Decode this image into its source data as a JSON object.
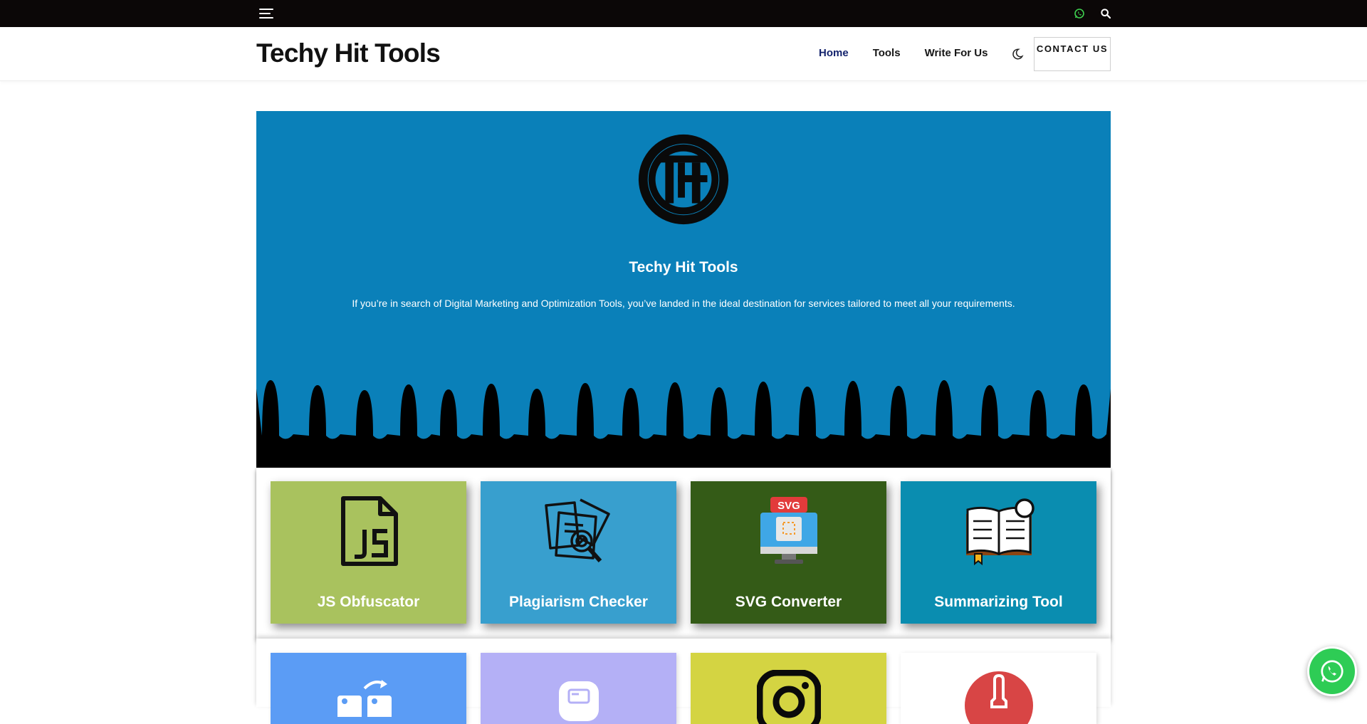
{
  "topbar": {
    "menu_icon": "hamburger-icon",
    "whatsapp_icon": "whatsapp-icon",
    "search_icon": "search-icon"
  },
  "header": {
    "brand": "Techy Hit Tools",
    "nav": [
      {
        "label": "Home",
        "active": true
      },
      {
        "label": "Tools",
        "active": false
      },
      {
        "label": "Write For Us",
        "active": false
      }
    ],
    "theme_icon": "moon-icon",
    "contact_label": "CONTACT US"
  },
  "hero": {
    "logo_icon": "th-logo-icon",
    "title": "Techy Hit Tools",
    "tagline": "If you’re in search of Digital Marketing and Optimization Tools, you’ve landed in the ideal destination for services tailored to meet all your requirements.",
    "bg_color": "#0a80b9"
  },
  "tools": [
    {
      "label": "JS Obfuscator",
      "color": "#a9c25e",
      "icon": "js-file-icon"
    },
    {
      "label": "Plagiarism Checker",
      "color": "#389fce",
      "icon": "documents-magnifier-icon"
    },
    {
      "label": "SVG Converter",
      "color": "#345b17",
      "icon": "svg-monitor-icon"
    },
    {
      "label": "Summarizing Tool",
      "color": "#0a8db0",
      "icon": "open-book-icon"
    }
  ],
  "tools_row2": [
    {
      "color": "#5b9cf5",
      "icon": "image-convert-icon"
    },
    {
      "color": "#b4b0f6",
      "icon": "app-screen-icon"
    },
    {
      "color": "#d4d442",
      "icon": "instagram-icon"
    },
    {
      "color": "#ffffff",
      "icon": "red-tool-icon"
    }
  ],
  "floating": {
    "whatsapp_icon": "whatsapp-icon"
  }
}
